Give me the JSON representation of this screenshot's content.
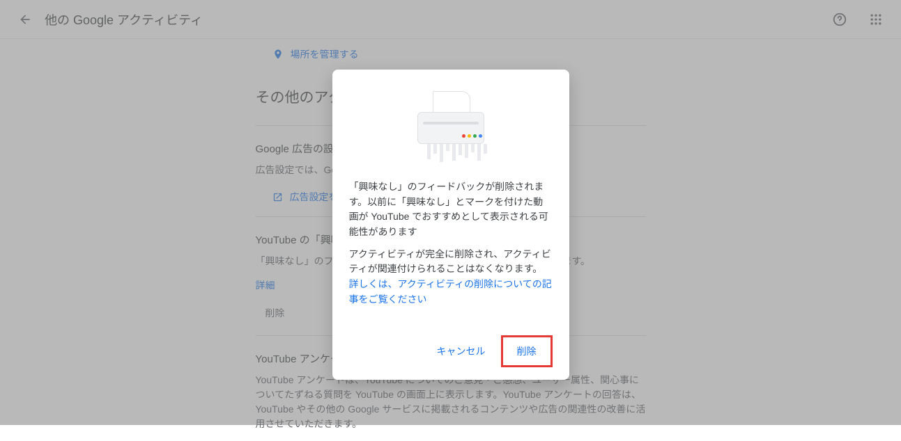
{
  "header": {
    "title": "他の Google アクティビティ"
  },
  "top_link": {
    "label": "場所を管理する"
  },
  "section": {
    "heading": "その他のアクティビティ"
  },
  "card_ads": {
    "title": "Google 広告の設定",
    "desc": "広告設定では、Google 広告の表示設定を管理できます。",
    "link_label": "広告設定を管理する"
  },
  "card_yt": {
    "title": "YouTube の「興味なし」のフィードバック",
    "desc": "「興味なし」のフィードバックを使って YouTube のおすすめを調整します。",
    "detail_label": "詳細",
    "delete_label": "削除"
  },
  "card_survey": {
    "title": "YouTube アンケート",
    "desc": "YouTube アンケートは、YouTube についてのご意見・ご感想、ユーザー属性、関心事についてたずねる質問を YouTube の画面上に表示します。YouTube アンケートの回答は、YouTube やその他の Google サービスに掲載されるコンテンツや広告の関連性の改善に活用させていただきます。"
  },
  "dialog": {
    "p1": "「興味なし」のフィードバックが削除されます。以前に「興味なし」とマークを付けた動画が YouTube でおすすめとして表示される可能性があります",
    "p2a": "アクティビティが完全に削除され、アクティビティが関連付けられることはなくなります。",
    "p2link": "詳しくは、アクティビティの削除についての記事をご覧ください",
    "cancel": "キャンセル",
    "confirm": "削除"
  }
}
